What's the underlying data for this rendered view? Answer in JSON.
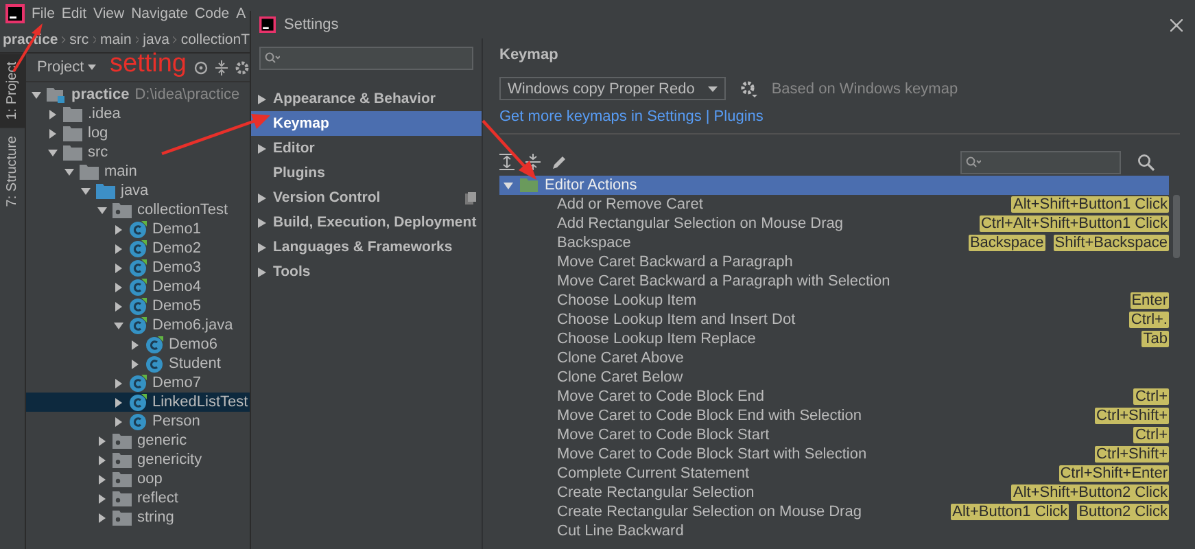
{
  "menu_bar": {
    "items": [
      "File",
      "Edit",
      "View",
      "Navigate",
      "Code",
      "A"
    ]
  },
  "breadcrumbs": [
    "practice",
    "src",
    "main",
    "java",
    "collectionT"
  ],
  "tool_strip": [
    {
      "label": "1: Project",
      "selected": true
    },
    {
      "label": "7: Structure",
      "selected": false
    }
  ],
  "project_panel": {
    "title": "Project",
    "tree": [
      {
        "label": "practice",
        "path": "D:\\idea\\practice",
        "kind": "module",
        "expanded": true,
        "selected": false,
        "children": [
          {
            "label": ".idea",
            "kind": "folder",
            "expanded": false,
            "selected": false
          },
          {
            "label": "log",
            "kind": "folder",
            "expanded": false,
            "selected": false
          },
          {
            "label": "src",
            "kind": "folder",
            "expanded": true,
            "selected": false,
            "children": [
              {
                "label": "main",
                "kind": "folder",
                "expanded": true,
                "selected": false,
                "children": [
                  {
                    "label": "java",
                    "kind": "source",
                    "expanded": true,
                    "selected": false,
                    "children": [
                      {
                        "label": "collectionTest",
                        "kind": "package",
                        "expanded": true,
                        "selected": false,
                        "children": [
                          {
                            "label": "Demo1",
                            "kind": "class",
                            "expanded": false,
                            "selected": false
                          },
                          {
                            "label": "Demo2",
                            "kind": "class",
                            "expanded": false,
                            "selected": false
                          },
                          {
                            "label": "Demo3",
                            "kind": "class",
                            "expanded": false,
                            "selected": false
                          },
                          {
                            "label": "Demo4",
                            "kind": "class",
                            "expanded": false,
                            "selected": false
                          },
                          {
                            "label": "Demo5",
                            "kind": "class",
                            "expanded": false,
                            "selected": false
                          },
                          {
                            "label": "Demo6.java",
                            "kind": "class",
                            "expanded": true,
                            "selected": false,
                            "children": [
                              {
                                "label": "Demo6",
                                "kind": "class",
                                "expanded": false,
                                "selected": false
                              },
                              {
                                "label": "Student",
                                "kind": "plain-class",
                                "expanded": false,
                                "selected": false
                              }
                            ]
                          },
                          {
                            "label": "Demo7",
                            "kind": "class",
                            "expanded": false,
                            "selected": false
                          },
                          {
                            "label": "LinkedListTest",
                            "kind": "class",
                            "expanded": false,
                            "selected": true
                          },
                          {
                            "label": "Person",
                            "kind": "plain-class",
                            "expanded": false,
                            "selected": false
                          }
                        ]
                      },
                      {
                        "label": "generic",
                        "kind": "package",
                        "expanded": false,
                        "selected": false
                      },
                      {
                        "label": "genericity",
                        "kind": "package",
                        "expanded": false,
                        "selected": false
                      },
                      {
                        "label": "oop",
                        "kind": "package",
                        "expanded": false,
                        "selected": false
                      },
                      {
                        "label": "reflect",
                        "kind": "package",
                        "expanded": false,
                        "selected": false
                      },
                      {
                        "label": "string",
                        "kind": "package",
                        "expanded": false,
                        "selected": false
                      }
                    ]
                  }
                ]
              }
            ]
          }
        ]
      }
    ]
  },
  "annotation": {
    "label": "setting"
  },
  "settings": {
    "title": "Settings",
    "nav": [
      {
        "label": "Appearance & Behavior",
        "expandable": true,
        "selected": false
      },
      {
        "label": "Keymap",
        "expandable": false,
        "selected": true
      },
      {
        "label": "Editor",
        "expandable": true,
        "selected": false
      },
      {
        "label": "Plugins",
        "expandable": false,
        "selected": false
      },
      {
        "label": "Version Control",
        "expandable": true,
        "selected": false
      },
      {
        "label": "Build, Execution, Deployment",
        "expandable": true,
        "selected": false
      },
      {
        "label": "Languages & Frameworks",
        "expandable": true,
        "selected": false
      },
      {
        "label": "Tools",
        "expandable": true,
        "selected": false
      }
    ],
    "keymap": {
      "title": "Keymap",
      "scheme": "Windows copy Proper Redo",
      "based_on": "Based on Windows keymap",
      "link": "Get more keymaps in Settings | Plugins",
      "group": {
        "label": "Editor Actions",
        "expanded": true,
        "selected": true
      },
      "actions": [
        {
          "label": "Add or Remove Caret",
          "shortcuts": [
            "Alt+Shift+Button1 Click"
          ]
        },
        {
          "label": "Add Rectangular Selection on Mouse Drag",
          "shortcuts": [
            "Ctrl+Alt+Shift+Button1 Click"
          ]
        },
        {
          "label": "Backspace",
          "shortcuts": [
            "Backspace",
            "Shift+Backspace"
          ]
        },
        {
          "label": "Move Caret Backward a Paragraph"
        },
        {
          "label": "Move Caret Backward a Paragraph with Selection"
        },
        {
          "label": "Choose Lookup Item",
          "shortcuts": [
            "Enter"
          ]
        },
        {
          "label": "Choose Lookup Item and Insert Dot",
          "shortcuts": [
            "Ctrl+."
          ]
        },
        {
          "label": "Choose Lookup Item Replace",
          "shortcuts": [
            "Tab"
          ]
        },
        {
          "label": "Clone Caret Above"
        },
        {
          "label": "Clone Caret Below"
        },
        {
          "label": "Move Caret to Code Block End",
          "shortcuts": [
            "Ctrl+"
          ]
        },
        {
          "label": "Move Caret to Code Block End with Selection",
          "shortcuts": [
            "Ctrl+Shift+"
          ]
        },
        {
          "label": "Move Caret to Code Block Start",
          "shortcuts": [
            "Ctrl+"
          ]
        },
        {
          "label": "Move Caret to Code Block Start with Selection",
          "shortcuts": [
            "Ctrl+Shift+"
          ]
        },
        {
          "label": "Complete Current Statement",
          "shortcuts": [
            "Ctrl+Shift+Enter"
          ]
        },
        {
          "label": "Create Rectangular Selection",
          "shortcuts": [
            "Alt+Shift+Button2 Click"
          ]
        },
        {
          "label": "Create Rectangular Selection on Mouse Drag",
          "shortcuts": [
            "Alt+Button1 Click",
            "Button2 Click"
          ]
        },
        {
          "label": "Cut Line Backward"
        }
      ]
    }
  }
}
